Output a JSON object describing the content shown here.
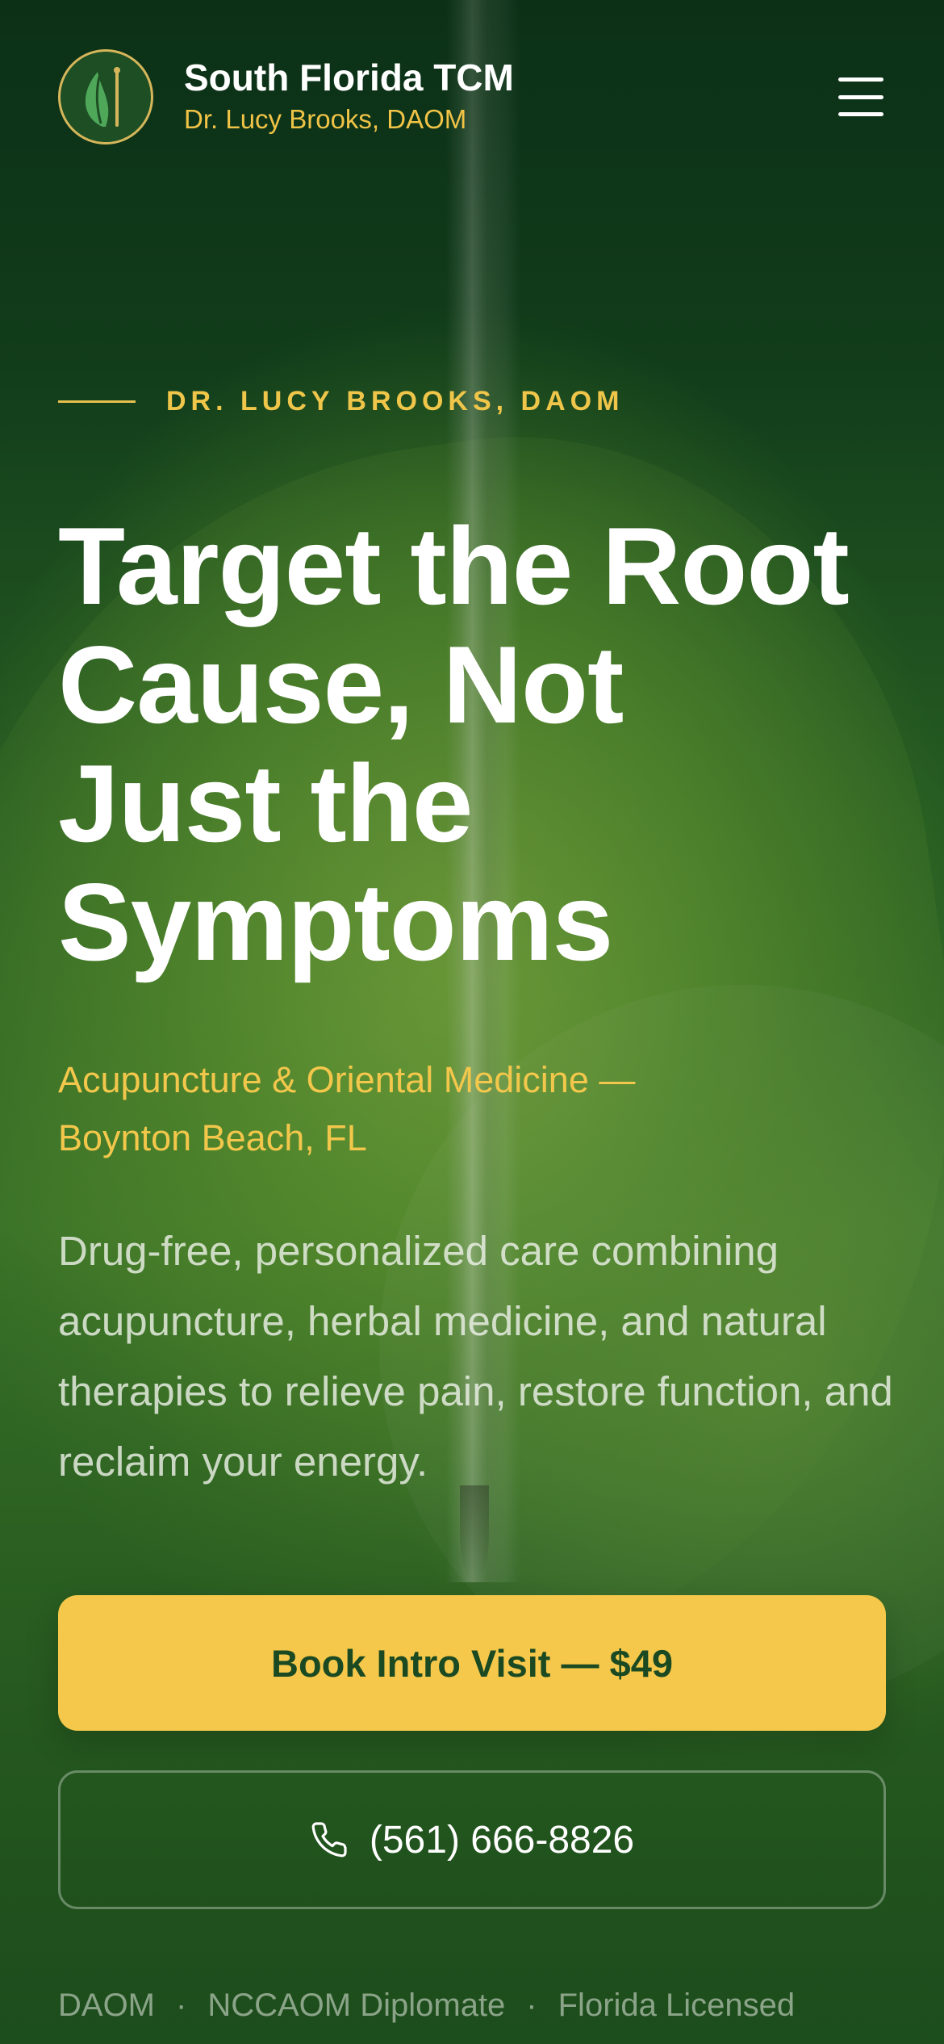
{
  "header": {
    "brand_name": "South Florida TCM",
    "brand_subtitle": "Dr. Lucy Brooks, DAOM",
    "logo_icon": "leaf-needle-icon",
    "menu_icon": "hamburger-menu-icon"
  },
  "hero": {
    "eyebrow": "DR. LUCY BROOKS, DAOM",
    "headline_lines": [
      "Target the Root",
      "Cause, Not",
      "Just the",
      "Symptoms"
    ],
    "subhead_lines": [
      "Acupuncture & Oriental Medicine —",
      "Boynton Beach, FL"
    ],
    "description": "Drug-free, personalized care combining acupuncture, herbal medicine, and natural therapies to relieve pain, restore function, and reclaim your energy."
  },
  "cta": {
    "primary_label": "Book Intro Visit — $49",
    "phone_label": "(561) 666-8826",
    "phone_icon": "phone-icon"
  },
  "credentials": [
    "DAOM",
    "NCCAOM Diplomate",
    "Florida Licensed"
  ],
  "colors": {
    "accent_gold": "#f5c84b",
    "deep_green": "#1b4a22",
    "text_white": "#ffffff"
  }
}
